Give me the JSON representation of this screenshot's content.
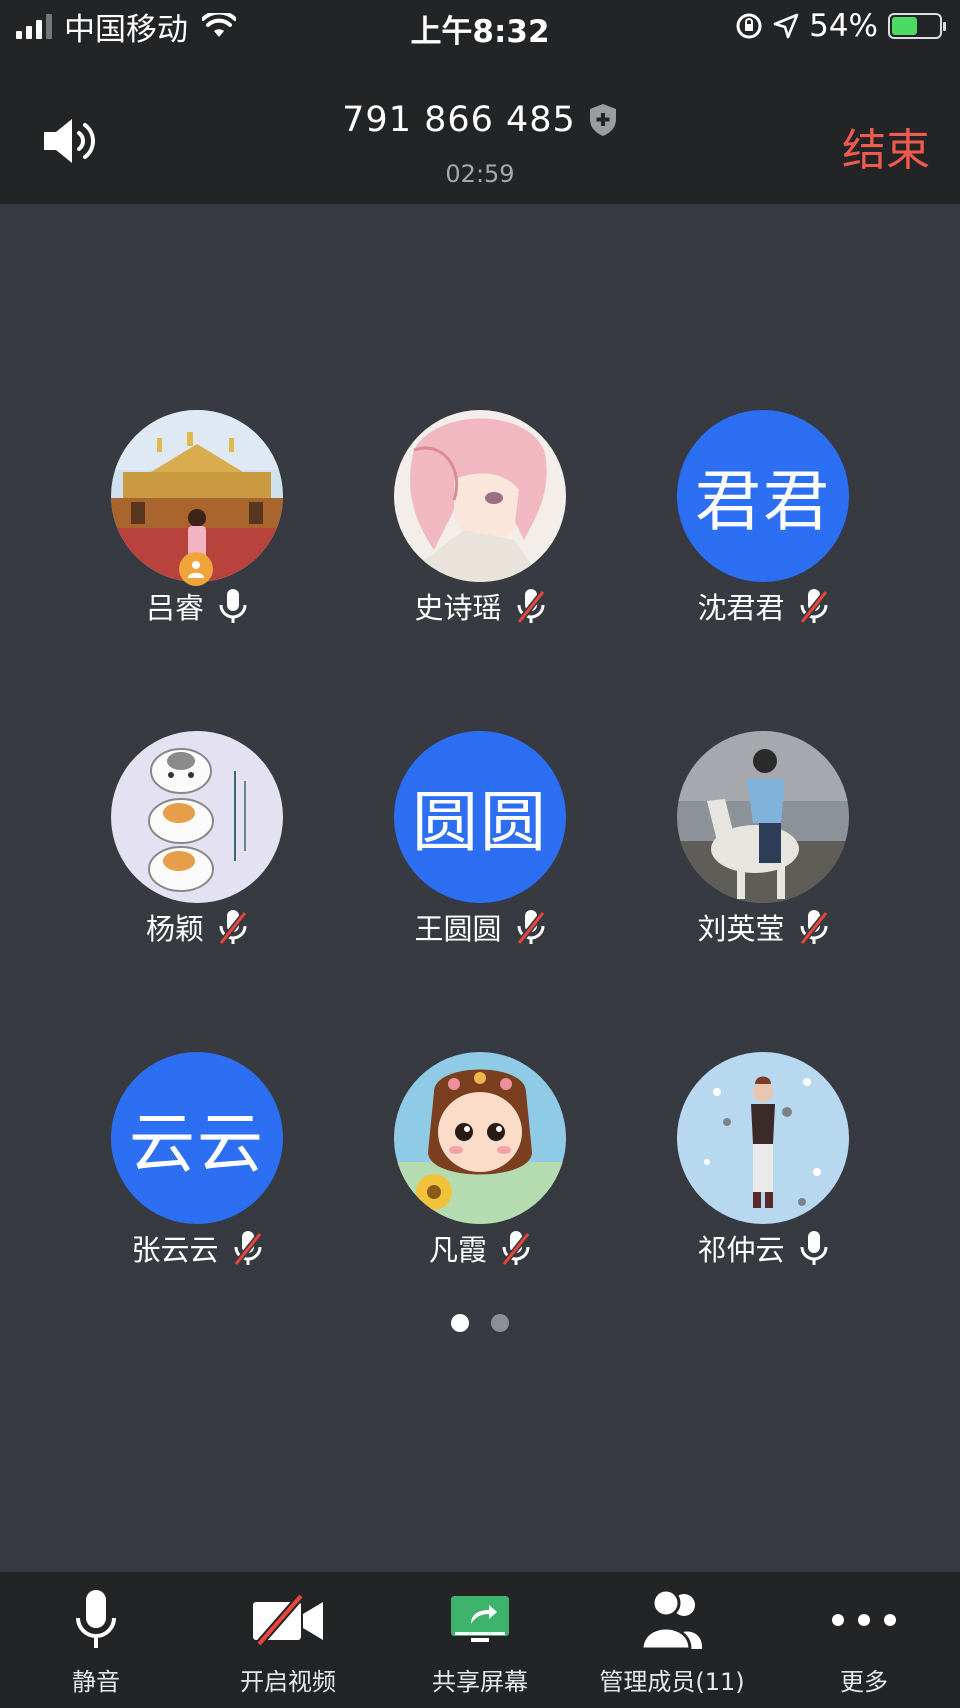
{
  "status_bar": {
    "carrier": "中国移动",
    "time": "上午8:32",
    "battery": "54%",
    "battery_level": 0.54
  },
  "header": {
    "meeting_id": "791 866 485",
    "elapsed": "02:59",
    "end_label": "结束"
  },
  "participants": [
    {
      "name": "吕睿",
      "avatar_type": "photo-temple",
      "mic": "on",
      "host": true
    },
    {
      "name": "史诗瑶",
      "avatar_type": "photo-anime",
      "mic": "muted"
    },
    {
      "name": "沈君君",
      "avatar_type": "text",
      "avatar_text": "君君",
      "mic": "muted"
    },
    {
      "name": "杨颖",
      "avatar_type": "photo-cats",
      "mic": "muted"
    },
    {
      "name": "王圆圆",
      "avatar_type": "text",
      "avatar_text": "圆圆",
      "mic": "muted"
    },
    {
      "name": "刘英莹",
      "avatar_type": "photo-horse",
      "mic": "muted"
    },
    {
      "name": "张云云",
      "avatar_type": "text",
      "avatar_text": "云云",
      "mic": "muted"
    },
    {
      "name": "凡霞",
      "avatar_type": "photo-cartoon-girl",
      "mic": "muted"
    },
    {
      "name": "祁仲云",
      "avatar_type": "photo-illustration",
      "mic": "on"
    }
  ],
  "pagination": {
    "pages": 2,
    "current": 1
  },
  "toolbar": {
    "mute": "静音",
    "video": "开启视频",
    "share": "共享屏幕",
    "members": "管理成员(11)",
    "more": "更多"
  },
  "colors": {
    "background": "#383a41",
    "bar": "#232426",
    "accent_blue": "#2d6ff3",
    "end_red": "#f05a4f",
    "share_green": "#3db36b",
    "host_badge": "#f0a53a"
  }
}
